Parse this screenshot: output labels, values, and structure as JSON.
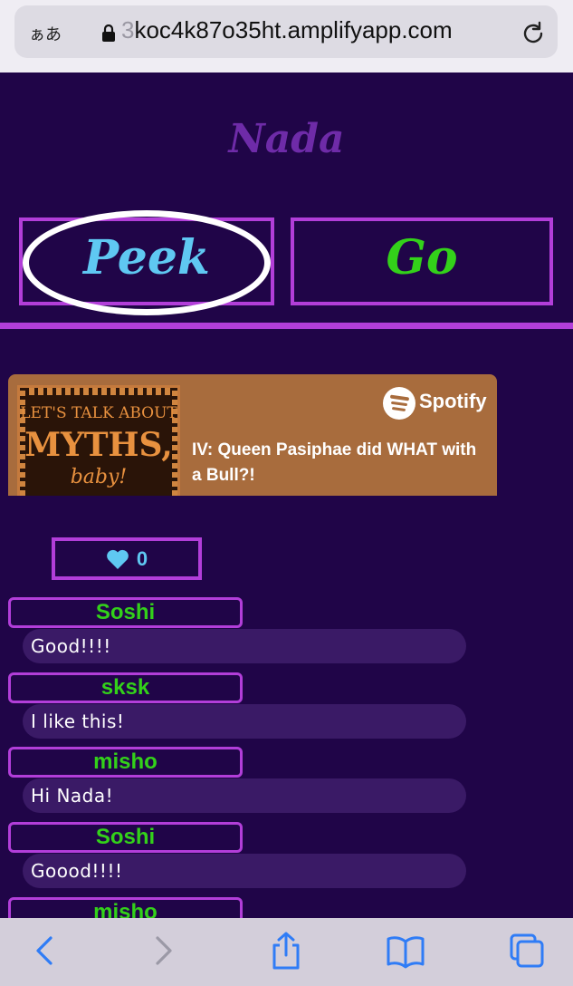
{
  "browser": {
    "text_size_label": "ぁあ",
    "url_hidden_prefix": "3",
    "url": "koc4k87o35ht.amplifyapp.com"
  },
  "app": {
    "title": "Nada",
    "tabs": [
      {
        "label": "Peek",
        "selected": true
      },
      {
        "label": "Go",
        "selected": false
      }
    ]
  },
  "spotify": {
    "brand": "Spotify",
    "episode_title": "IV: Queen Pasiphae did WHAT with a Bull?!",
    "cover": {
      "line1": "LET'S TALK ABOUT",
      "line2": "MYTHS,",
      "line3": "baby!"
    }
  },
  "likes": {
    "count": "0"
  },
  "comments": [
    {
      "author": "Soshi",
      "text": "Good!!!!"
    },
    {
      "author": "sksk",
      "text": "I like this!"
    },
    {
      "author": "misho",
      "text": "Hi Nada!"
    },
    {
      "author": "Soshi",
      "text": "Goood!!!!"
    },
    {
      "author": "misho",
      "text": ""
    }
  ],
  "colors": {
    "background": "#200548",
    "accent_border": "#b23ed9",
    "peek_text": "#5fc8f2",
    "go_text": "#33d11a",
    "spotify_bg": "#a86c3d"
  }
}
